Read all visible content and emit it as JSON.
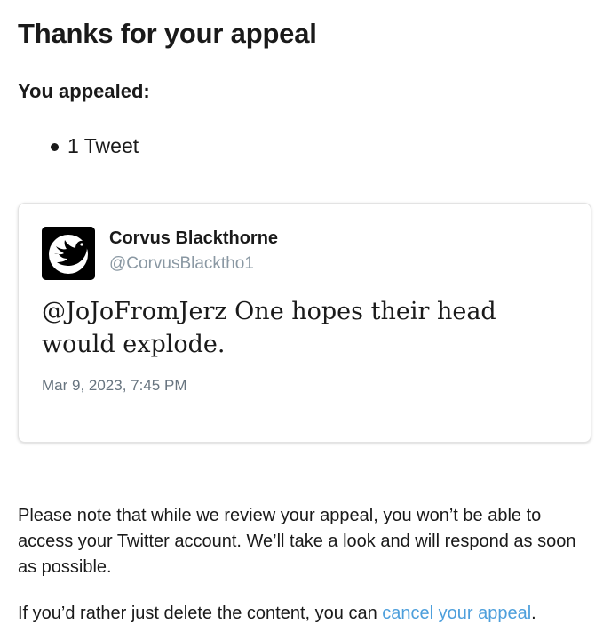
{
  "page": {
    "title": "Thanks for your appeal"
  },
  "appealed": {
    "heading": "You appealed:",
    "items": [
      "1 Tweet"
    ]
  },
  "tweet": {
    "author_name": "Corvus Blackthorne",
    "author_handle": "@CorvusBlacktho1",
    "text": "@JoJoFromJerz One hopes their head would explode.",
    "timestamp": "Mar 9, 2023, 7:45 PM",
    "avatar_icon": "bird-silhouette-icon"
  },
  "notice": {
    "text": "Please note that while we review your appeal, you won’t be able to access your Twitter account. We’ll take a look and will respond as soon as possible."
  },
  "delete_option": {
    "prefix": "If you’d rather just delete the content, you can ",
    "link_label": "cancel your appeal",
    "suffix": "."
  },
  "colors": {
    "link": "#4d9fdc",
    "handle": "#8a98a3",
    "text": "#1a1a1a"
  }
}
